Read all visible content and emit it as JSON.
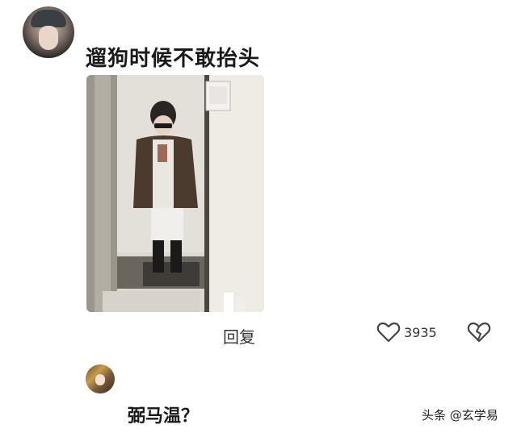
{
  "post": {
    "text": "遛狗时候不敢抬头",
    "reply_label": "回复",
    "like_count": "3935"
  },
  "comment": {
    "text": "弼马温？"
  },
  "watermark": "头条 @玄学易",
  "icons": {
    "like": "heart-outline-icon",
    "dislike": "broken-heart-icon"
  }
}
